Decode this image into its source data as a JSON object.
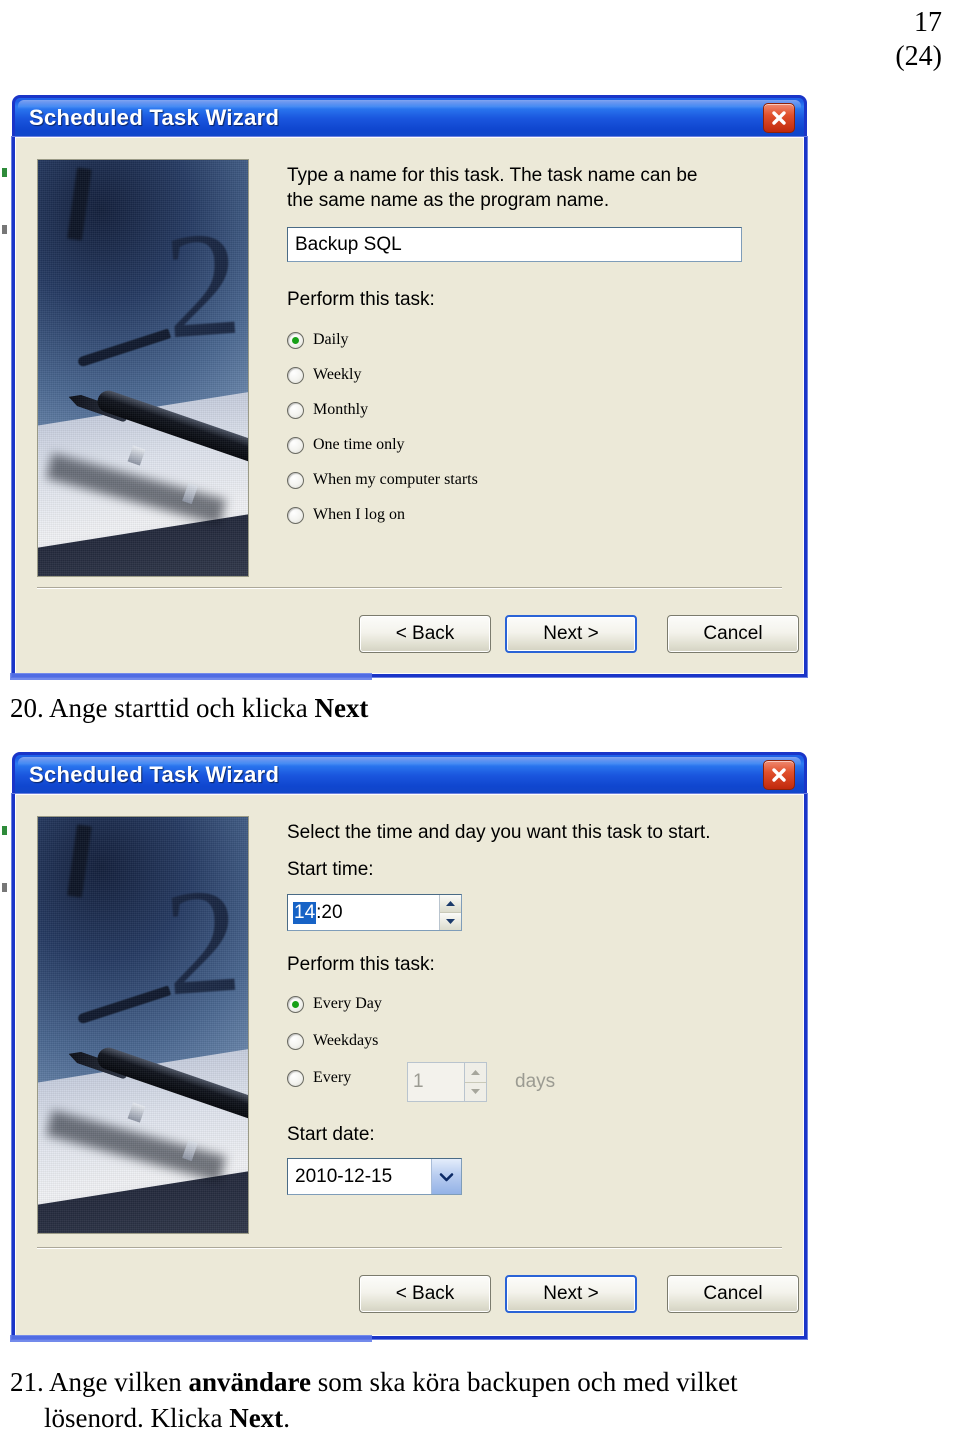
{
  "page": {
    "number": "17",
    "total": "(24)"
  },
  "dialogs": [
    {
      "title": "Scheduled Task Wizard",
      "close_icon": "close-x-icon",
      "instruction": "Type a name for this task.  The task name can be\nthe same name as the program name.",
      "task_name_value": "Backup SQL",
      "perform_label": "Perform this task:",
      "options": [
        {
          "label": "Daily",
          "selected": true
        },
        {
          "label": "Weekly",
          "selected": false
        },
        {
          "label": "Monthly",
          "selected": false
        },
        {
          "label": "One time only",
          "selected": false
        },
        {
          "label": "When my computer starts",
          "selected": false
        },
        {
          "label": "When I log on",
          "selected": false
        }
      ],
      "buttons": {
        "back": "< Back",
        "next": "Next >",
        "cancel": "Cancel"
      }
    },
    {
      "title": "Scheduled Task Wizard",
      "close_icon": "close-x-icon",
      "instruction": "Select the time and day you want this task to start.",
      "start_time_label": "Start time:",
      "start_time_selected": "14",
      "start_time_rest": ":20",
      "perform_label": "Perform this task:",
      "options": [
        {
          "label": "Every Day",
          "selected": true
        },
        {
          "label": "Weekdays",
          "selected": false
        },
        {
          "label": "Every",
          "selected": false
        }
      ],
      "every_days_value": "1",
      "every_days_unit": "days",
      "start_date_label": "Start date:",
      "start_date_value": "2010-12-15",
      "buttons": {
        "back": "< Back",
        "next": "Next >",
        "cancel": "Cancel"
      }
    }
  ],
  "captions": {
    "step20_num": "20.",
    "step20_text_a": "Ange starttid och klicka ",
    "step20_bold": "Next",
    "step21_num": "21.",
    "step21_text_a": "Ange vilken ",
    "step21_bold_a": "användare",
    "step21_text_b": " som ska köra backupen och med vilket",
    "step21_text_c": "lösenord. Klicka ",
    "step21_bold_b": "Next",
    "step21_text_d": "."
  },
  "colors": {
    "titlebar_blue": "#1a56de",
    "dialog_face": "#ece9d8",
    "close_red": "#c0290c",
    "radio_green": "#17a017",
    "selection_blue": "#1763c6",
    "frame_blue": "#1a35c8"
  }
}
